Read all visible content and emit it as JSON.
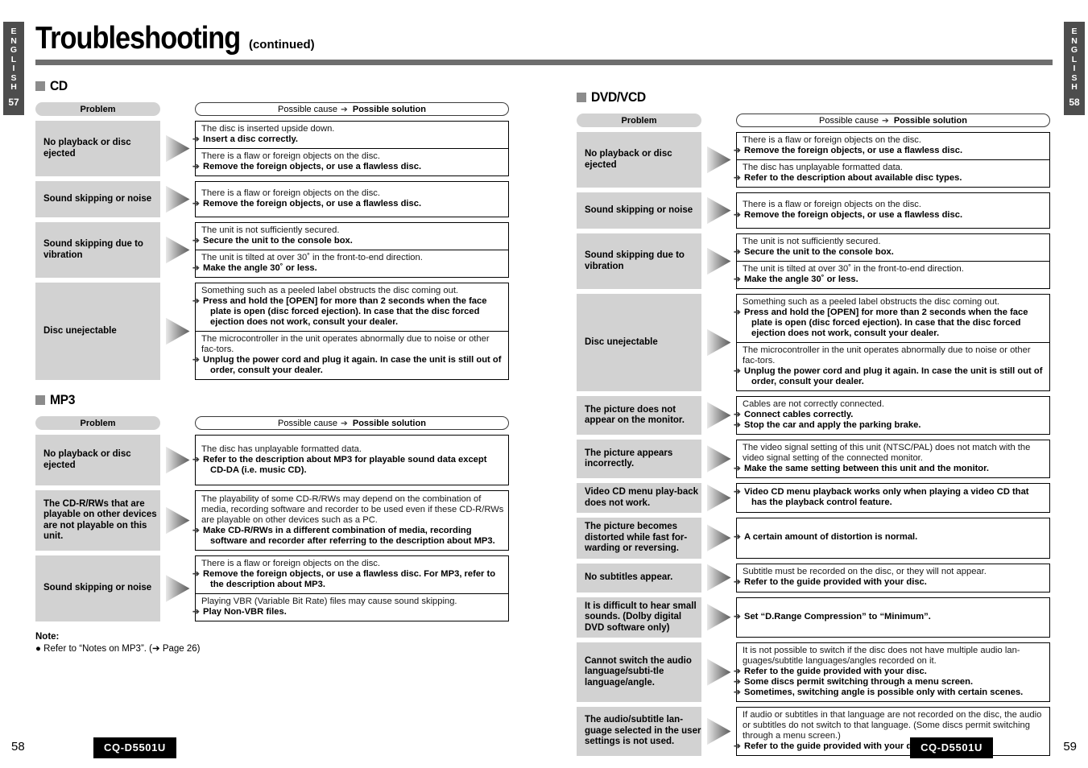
{
  "header": {
    "title": "Troubleshooting",
    "subtitle": "(continued)"
  },
  "side_tabs": {
    "left": {
      "letters": [
        "E",
        "N",
        "G",
        "L",
        "I",
        "S",
        "H"
      ],
      "page": "57"
    },
    "right": {
      "letters": [
        "E",
        "N",
        "G",
        "L",
        "I",
        "S",
        "H"
      ],
      "page": "58"
    }
  },
  "column_headers": {
    "problem": "Problem",
    "cause_label": "Possible cause",
    "solution_label": "Possible solution",
    "arrow_glyph": "➔"
  },
  "sections": [
    {
      "id": "cd",
      "title": "CD",
      "rows": [
        {
          "problem": "No playback or disc ejected",
          "answers": [
            {
              "cause": "The disc is inserted upside down.",
              "solutions": [
                "Insert a disc correctly."
              ]
            },
            {
              "cause": "There is a flaw or foreign objects on the disc.",
              "solutions": [
                "Remove the foreign objects, or use a flawless disc."
              ]
            }
          ]
        },
        {
          "problem": "Sound skipping or noise",
          "answers": [
            {
              "cause": "There is a flaw or foreign objects on the disc.",
              "solutions": [
                "Remove the foreign objects, or use a flawless disc."
              ]
            }
          ]
        },
        {
          "problem": "Sound skipping due to vibration",
          "answers": [
            {
              "cause": "The unit is not sufficiently secured.",
              "solutions": [
                "Secure the unit to the console box."
              ]
            },
            {
              "cause": "The unit is tilted at over 30˚ in the front-to-end direction.",
              "solutions": [
                "Make the angle 30˚ or less."
              ]
            }
          ]
        },
        {
          "problem": "Disc unejectable",
          "answers": [
            {
              "cause": "Something such as a peeled label obstructs the disc coming out.",
              "solutions": [
                "Press and hold the [OPEN] for more than 2 seconds when the face plate is open (disc forced ejection). In case that the disc forced ejection does not work, consult your dealer."
              ]
            },
            {
              "cause": "The microcontroller in the unit operates abnormally due to noise or other fac-tors.",
              "solutions": [
                "Unplug the power cord and plug it again. In case the unit is still out of order, consult your dealer."
              ]
            }
          ]
        }
      ]
    },
    {
      "id": "mp3",
      "title": "MP3",
      "rows": [
        {
          "problem": "No playback or disc ejected",
          "answers": [
            {
              "cause": "The disc has unplayable formatted data.",
              "solutions": [
                "Refer to the description about MP3 for playable sound data except CD-DA (i.e. music CD)."
              ]
            }
          ]
        },
        {
          "problem": "The CD-R/RWs that are playable on other devices are not playable on this unit.",
          "answers": [
            {
              "cause": "The playability of some CD-R/RWs may depend on the combination of media, recording software and recorder to be used even if these CD-R/RWs are playable on other devices such as a PC.",
              "solutions": [
                "Make CD-R/RWs in a different combination of media, recording software and recorder after referring to the description about MP3."
              ]
            }
          ]
        },
        {
          "problem": "Sound skipping or noise",
          "answers": [
            {
              "cause": "There is a flaw or foreign objects on the disc.",
              "solutions": [
                "Remove the foreign objects, or use a flawless disc. For MP3, refer to the description about MP3."
              ]
            },
            {
              "cause": "Playing VBR (Variable Bit Rate) files may cause sound skipping.",
              "solutions": [
                "Play Non-VBR files."
              ]
            }
          ]
        }
      ]
    },
    {
      "id": "dvd-vcd",
      "title": "DVD/VCD",
      "rows": [
        {
          "problem": "No playback or disc ejected",
          "answers": [
            {
              "cause": "There is a flaw or foreign objects on the disc.",
              "solutions": [
                "Remove the foreign objects, or use a flawless disc."
              ]
            },
            {
              "cause": "The disc has unplayable formatted data.",
              "solutions": [
                "Refer to the description about available disc types."
              ]
            }
          ]
        },
        {
          "problem": "Sound skipping or noise",
          "answers": [
            {
              "cause": "There is a flaw or foreign objects on the disc.",
              "solutions": [
                "Remove the foreign objects, or use a flawless disc."
              ]
            }
          ]
        },
        {
          "problem": "Sound skipping due to vibration",
          "answers": [
            {
              "cause": "The unit is not sufficiently secured.",
              "solutions": [
                "Secure the unit to the console box."
              ]
            },
            {
              "cause": "The unit is tilted at over 30˚ in the front-to-end direction.",
              "solutions": [
                "Make the angle 30˚ or less."
              ]
            }
          ]
        },
        {
          "problem": "Disc unejectable",
          "answers": [
            {
              "cause": "Something such as a peeled label obstructs the disc coming out.",
              "solutions": [
                "Press and hold the [OPEN] for more than 2 seconds when the face plate is open (disc forced ejection). In case that the disc forced ejection does not work, consult your dealer."
              ]
            },
            {
              "cause": "The microcontroller in the unit operates abnormally due to noise or other fac-tors.",
              "solutions": [
                "Unplug the power cord and plug it again. In case the unit is still out of order, consult your dealer."
              ]
            }
          ]
        },
        {
          "problem": "The picture does not appear on the monitor.",
          "answers": [
            {
              "cause": "Cables are not correctly connected.",
              "solutions": [
                "Connect cables correctly.",
                "Stop the car and apply the parking brake."
              ]
            }
          ]
        },
        {
          "problem": "The picture appears incorrectly.",
          "answers": [
            {
              "cause": "The video signal setting of this unit (NTSC/PAL) does not match with the video signal setting of the connected monitor.",
              "solutions": [
                "Make the same setting between this unit and the monitor."
              ]
            }
          ]
        },
        {
          "problem": "Video CD menu play-back does not work.",
          "answers": [
            {
              "cause": "",
              "solutions": [
                "Video CD menu playback works only when playing a video CD that has the playback control feature."
              ]
            }
          ]
        },
        {
          "problem": "The picture becomes distorted while fast for-warding or reversing.",
          "answers": [
            {
              "cause": "",
              "solutions": [
                "A certain amount of distortion is normal."
              ]
            }
          ]
        },
        {
          "problem": "No subtitles appear.",
          "answers": [
            {
              "cause": "Subtitle must be recorded on the disc, or they will not appear.",
              "solutions": [
                "Refer to the guide provided with your disc."
              ]
            }
          ]
        },
        {
          "problem": "It is difficult to hear small sounds. (Dolby digital DVD software only)",
          "answers": [
            {
              "cause": "",
              "solutions": [
                "Set “D.Range Compression” to “Minimum”."
              ]
            }
          ]
        },
        {
          "problem": "Cannot switch the audio language/subti-tle language/angle.",
          "answers": [
            {
              "cause": "It is not possible to switch if the disc does not have multiple audio lan-guages/subtitle languages/angles recorded on it.",
              "solutions": [
                "Refer to the guide provided with your disc.",
                "Some discs permit switching through a menu screen.",
                "Sometimes, switching angle is possible only with certain scenes."
              ]
            }
          ]
        },
        {
          "problem": "The audio/subtitle lan-guage selected in the user settings is not used.",
          "answers": [
            {
              "cause": "If audio or subtitles in that language are not recorded on the disc, the audio or subtitles do not switch to that language. (Some discs permit switching through a menu screen.)",
              "solutions": [
                "Refer to the guide provided with your disc."
              ]
            }
          ]
        }
      ]
    }
  ],
  "note": {
    "title": "Note:",
    "items": [
      "Refer to “Notes on MP3”. (➔ Page 26)"
    ]
  },
  "footer": {
    "left_page": "58",
    "right_page": "59",
    "model": "CQ-D5501U"
  },
  "colors": {
    "tab_bg": "#4d4d4d",
    "rule": "#6e6e6e",
    "problem_bg": "#d2d2d2",
    "section_square": "#8c8c8c"
  }
}
